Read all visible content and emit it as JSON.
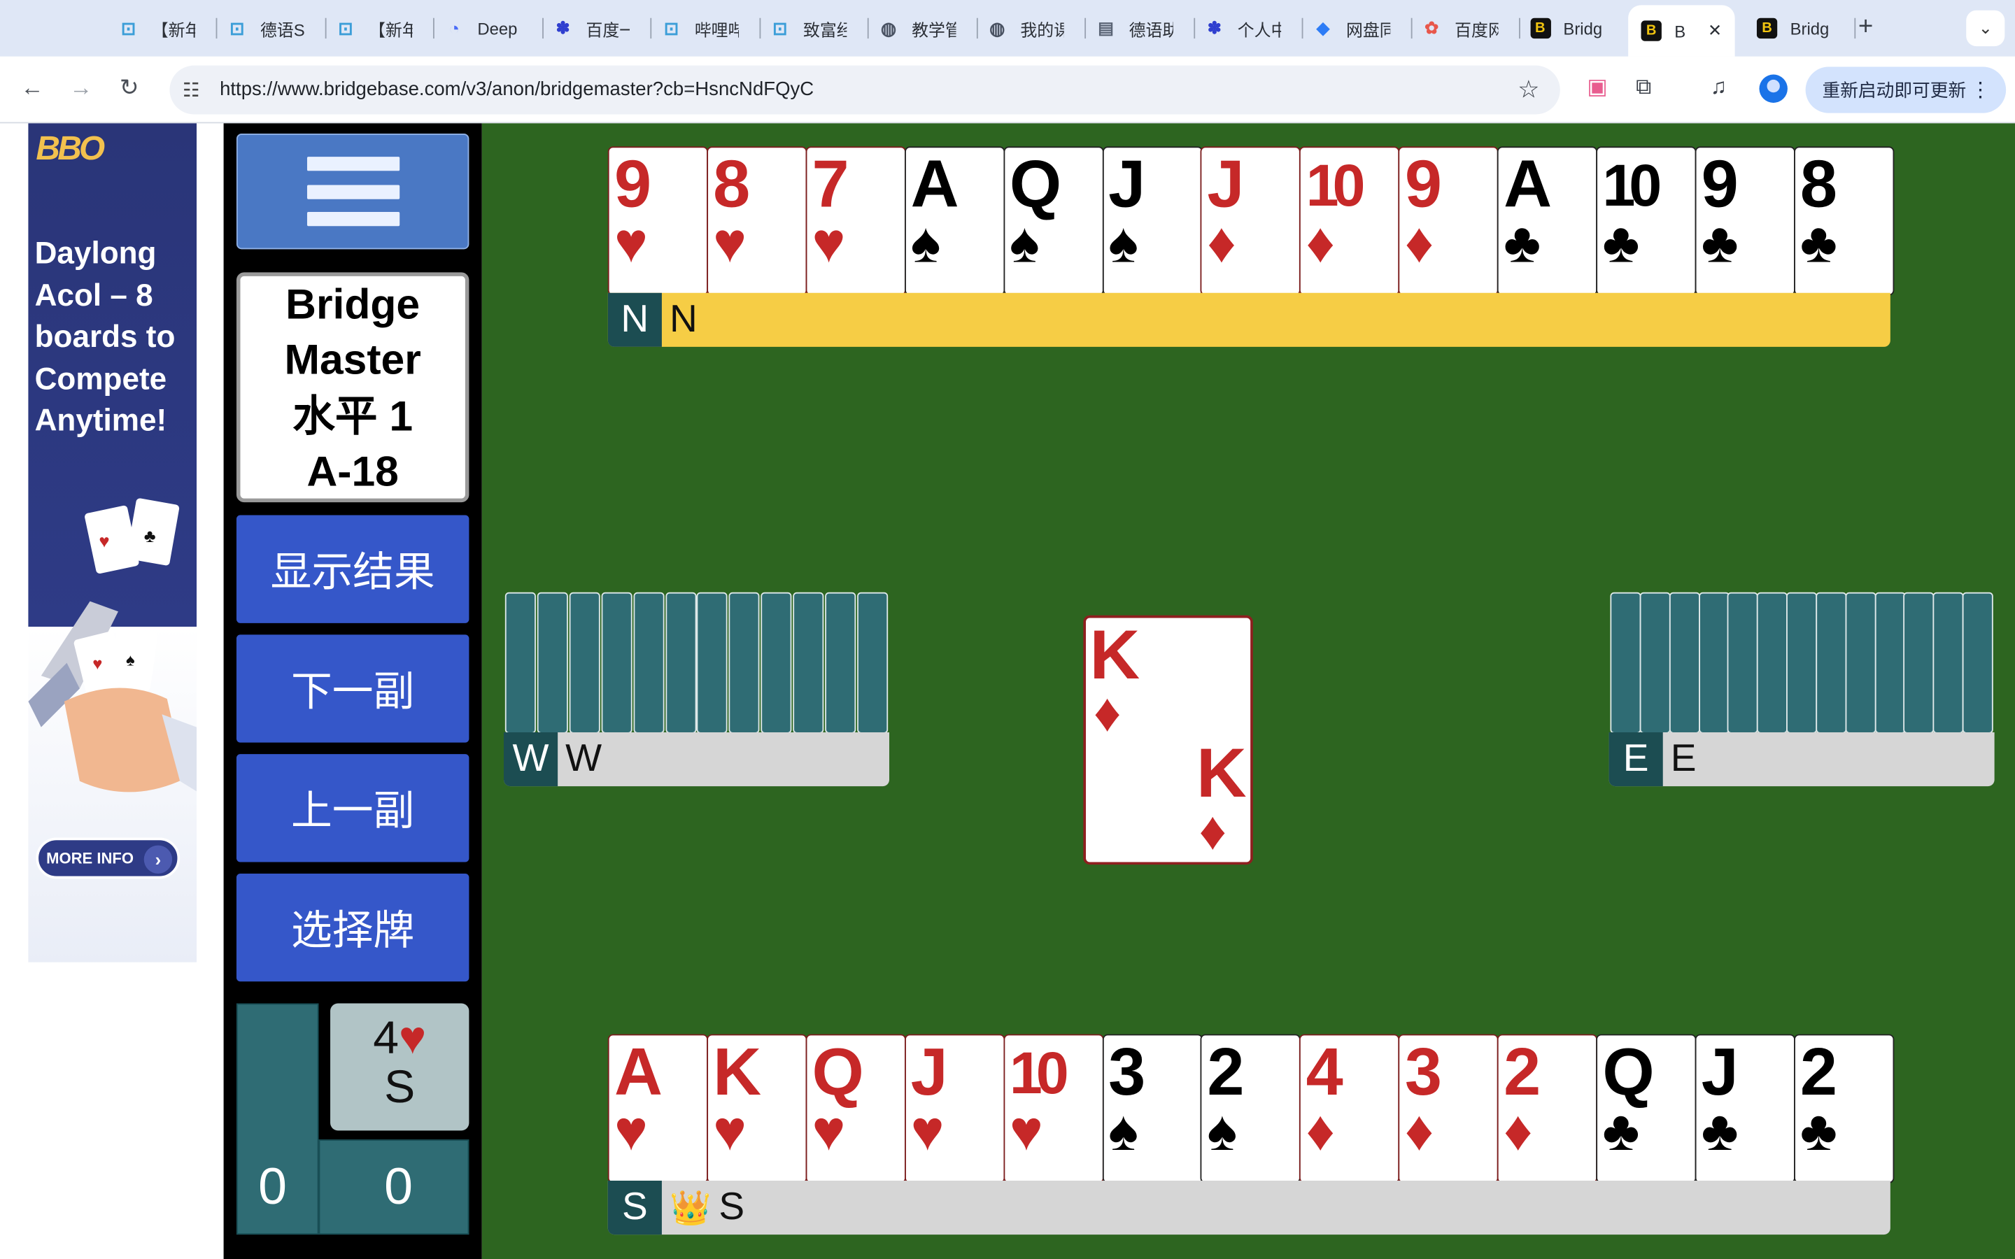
{
  "browser": {
    "tabs": [
      {
        "label": "【新年",
        "icon": "bilibili-icon"
      },
      {
        "label": "德语S",
        "icon": "bilibili-icon"
      },
      {
        "label": "【新年",
        "icon": "bilibili-icon"
      },
      {
        "label": "Deep",
        "icon": "deepseek-icon"
      },
      {
        "label": "百度一",
        "icon": "baidu-icon"
      },
      {
        "label": "哔哩哔",
        "icon": "bilibili-icon"
      },
      {
        "label": "致富经",
        "icon": "bilibili-icon"
      },
      {
        "label": "教学管",
        "icon": "globe-icon"
      },
      {
        "label": "我的课",
        "icon": "globe-icon"
      },
      {
        "label": "德语助",
        "icon": "document-icon"
      },
      {
        "label": "个人中",
        "icon": "baidu-icon"
      },
      {
        "label": "网盘同",
        "icon": "baidu-pan-icon"
      },
      {
        "label": "百度网",
        "icon": "baidu-netdisk-icon"
      },
      {
        "label": "Bridg",
        "icon": "bbo-icon"
      },
      {
        "label": "B",
        "icon": "bbo-icon",
        "active": true
      },
      {
        "label": "Bridg",
        "icon": "bbo-icon"
      }
    ],
    "new_tab": "+",
    "tab_search": "⌄",
    "close": "✕",
    "url": "https://www.bridgebase.com/v3/anon/bridgemaster?cb=HsncNdFQyC",
    "update_label": "重新启动即可更新"
  },
  "ad": {
    "logo": "BBO",
    "headline": "Daylong Acol – 8 boards to Compete Anytime!",
    "cta": "MORE INFO"
  },
  "panel": {
    "title_lines": [
      "Bridge",
      "Master",
      "水平 1",
      "A-18"
    ],
    "show_results": "显示结果",
    "next_deal": "下一副",
    "prev_deal": "上一副",
    "choose_card": "选择牌",
    "contract_level": "4",
    "contract_suit": "♥",
    "declarer": "S",
    "score_left": "0",
    "score_right": "0"
  },
  "table": {
    "north": {
      "seat": "N",
      "name": "N",
      "cards": [
        {
          "rank": "9",
          "suit": "♥",
          "color": "red"
        },
        {
          "rank": "8",
          "suit": "♥",
          "color": "red"
        },
        {
          "rank": "7",
          "suit": "♥",
          "color": "red"
        },
        {
          "rank": "A",
          "suit": "♠",
          "color": "black"
        },
        {
          "rank": "Q",
          "suit": "♠",
          "color": "black"
        },
        {
          "rank": "J",
          "suit": "♠",
          "color": "black"
        },
        {
          "rank": "J",
          "suit": "♦",
          "color": "red"
        },
        {
          "rank": "10",
          "suit": "♦",
          "color": "red"
        },
        {
          "rank": "9",
          "suit": "♦",
          "color": "red"
        },
        {
          "rank": "A",
          "suit": "♣",
          "color": "black"
        },
        {
          "rank": "10",
          "suit": "♣",
          "color": "black"
        },
        {
          "rank": "9",
          "suit": "♣",
          "color": "black"
        },
        {
          "rank": "8",
          "suit": "♣",
          "color": "black"
        }
      ]
    },
    "west": {
      "seat": "W",
      "name": "W",
      "hidden_count": 12
    },
    "east": {
      "seat": "E",
      "name": "E",
      "hidden_count": 13
    },
    "south": {
      "seat": "S",
      "name": "S",
      "crown": "👑",
      "cards": [
        {
          "rank": "A",
          "suit": "♥",
          "color": "red"
        },
        {
          "rank": "K",
          "suit": "♥",
          "color": "red"
        },
        {
          "rank": "Q",
          "suit": "♥",
          "color": "red"
        },
        {
          "rank": "J",
          "suit": "♥",
          "color": "red"
        },
        {
          "rank": "10",
          "suit": "♥",
          "color": "red"
        },
        {
          "rank": "3",
          "suit": "♠",
          "color": "black"
        },
        {
          "rank": "2",
          "suit": "♠",
          "color": "black"
        },
        {
          "rank": "4",
          "suit": "♦",
          "color": "red"
        },
        {
          "rank": "3",
          "suit": "♦",
          "color": "red"
        },
        {
          "rank": "2",
          "suit": "♦",
          "color": "red"
        },
        {
          "rank": "Q",
          "suit": "♣",
          "color": "black"
        },
        {
          "rank": "J",
          "suit": "♣",
          "color": "black"
        },
        {
          "rank": "2",
          "suit": "♣",
          "color": "black"
        }
      ]
    },
    "played_card": {
      "rank": "K",
      "suit": "♦",
      "color": "red"
    }
  },
  "colors": {
    "felt": "#2d6520",
    "north_bar": "#f6cd45",
    "panel_button": "#3557c9",
    "seat_badge": "#1c4d52"
  }
}
